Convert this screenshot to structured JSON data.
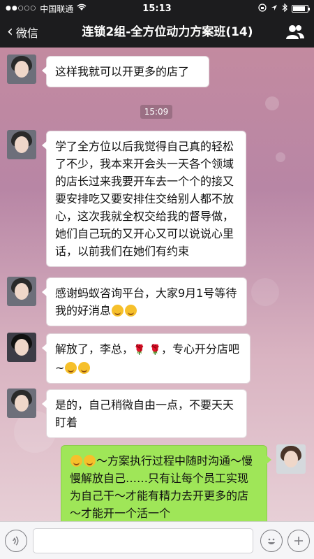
{
  "status": {
    "carrier": "中国联通",
    "time": "15:13",
    "battery": 0.85
  },
  "nav": {
    "back_label": "微信",
    "title": "连锁2组-全方位动力方案班(14)"
  },
  "chat": {
    "timestamp": "15:09",
    "messages": [
      {
        "sender": "other",
        "text": "这样我就可以开更多的店了"
      },
      {
        "sender": "other",
        "text": "学了全方位以后我觉得自己真的轻松了不少，我本来开会头一天各个领域的店长过来我要开车去一个个的接又要安排吃又要安排住交给别人都不放心，这次我就全权交给我的督导做，她们自己玩的又开心又可以说说心里话，以前我们在她们有约束"
      },
      {
        "sender": "other",
        "text": "感谢蚂蚁咨询平台，大家9月1号等待我的好消息"
      },
      {
        "sender": "other",
        "text_a": "解放了，李总，",
        "text_b": "，专心开分店吧~"
      },
      {
        "sender": "other",
        "text": "是的，自己稍微自由一点，不要天天盯着"
      },
      {
        "sender": "me",
        "text": "～方案执行过程中随时沟通～慢慢解放自己……只有让每个员工实现为自己干～才能有精力去开更多的店～才能开一个活一个"
      }
    ]
  },
  "icons": {
    "back": "chevron-left-icon",
    "group": "group-icon",
    "voice": "voice-icon",
    "emoji": "emoji-icon",
    "plus": "plus-icon"
  }
}
